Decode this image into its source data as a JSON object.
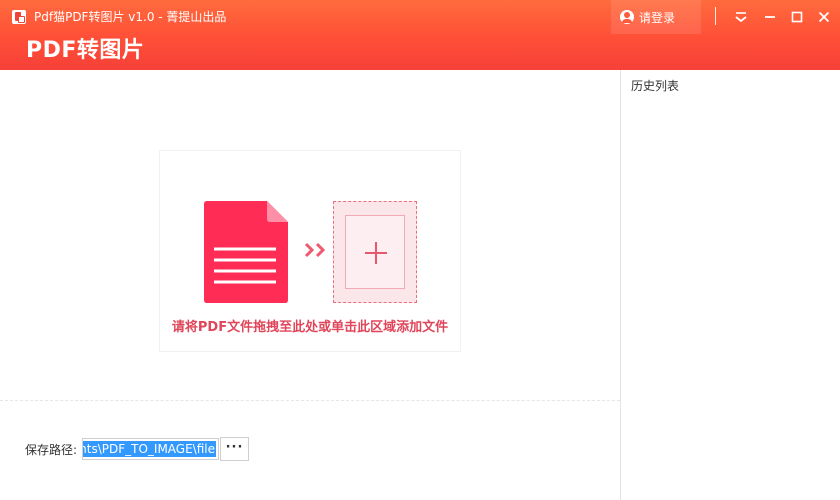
{
  "window": {
    "title": "Pdf猫PDF转图片 v1.0 - 菁提山出品",
    "login_label": "请登录"
  },
  "header": {
    "heading": "PDF转图片"
  },
  "drop_zone": {
    "hint": "请将PDF文件拖拽至此处或单击此区域添加文件",
    "arrows": "››"
  },
  "sidebar": {
    "title": "历史列表"
  },
  "save_path": {
    "label": "保存路径:",
    "value": "nts\\PDF_TO_IMAGE\\file",
    "browse_label": "···"
  },
  "colors": {
    "brand_orange": "#ff6b3d",
    "brand_red": "#f64039",
    "accent_pink": "#ff2d55",
    "hint_text": "#e0465a"
  },
  "icons": {
    "app": "pdf-cat-app-icon",
    "user": "user-circle-icon",
    "dropdown": "chevron-down-icon",
    "minimize": "minimize-icon",
    "maximize": "maximize-icon",
    "close": "close-icon",
    "document": "pdf-document-icon",
    "arrows": "double-chevron-right-icon",
    "add": "plus-icon"
  }
}
